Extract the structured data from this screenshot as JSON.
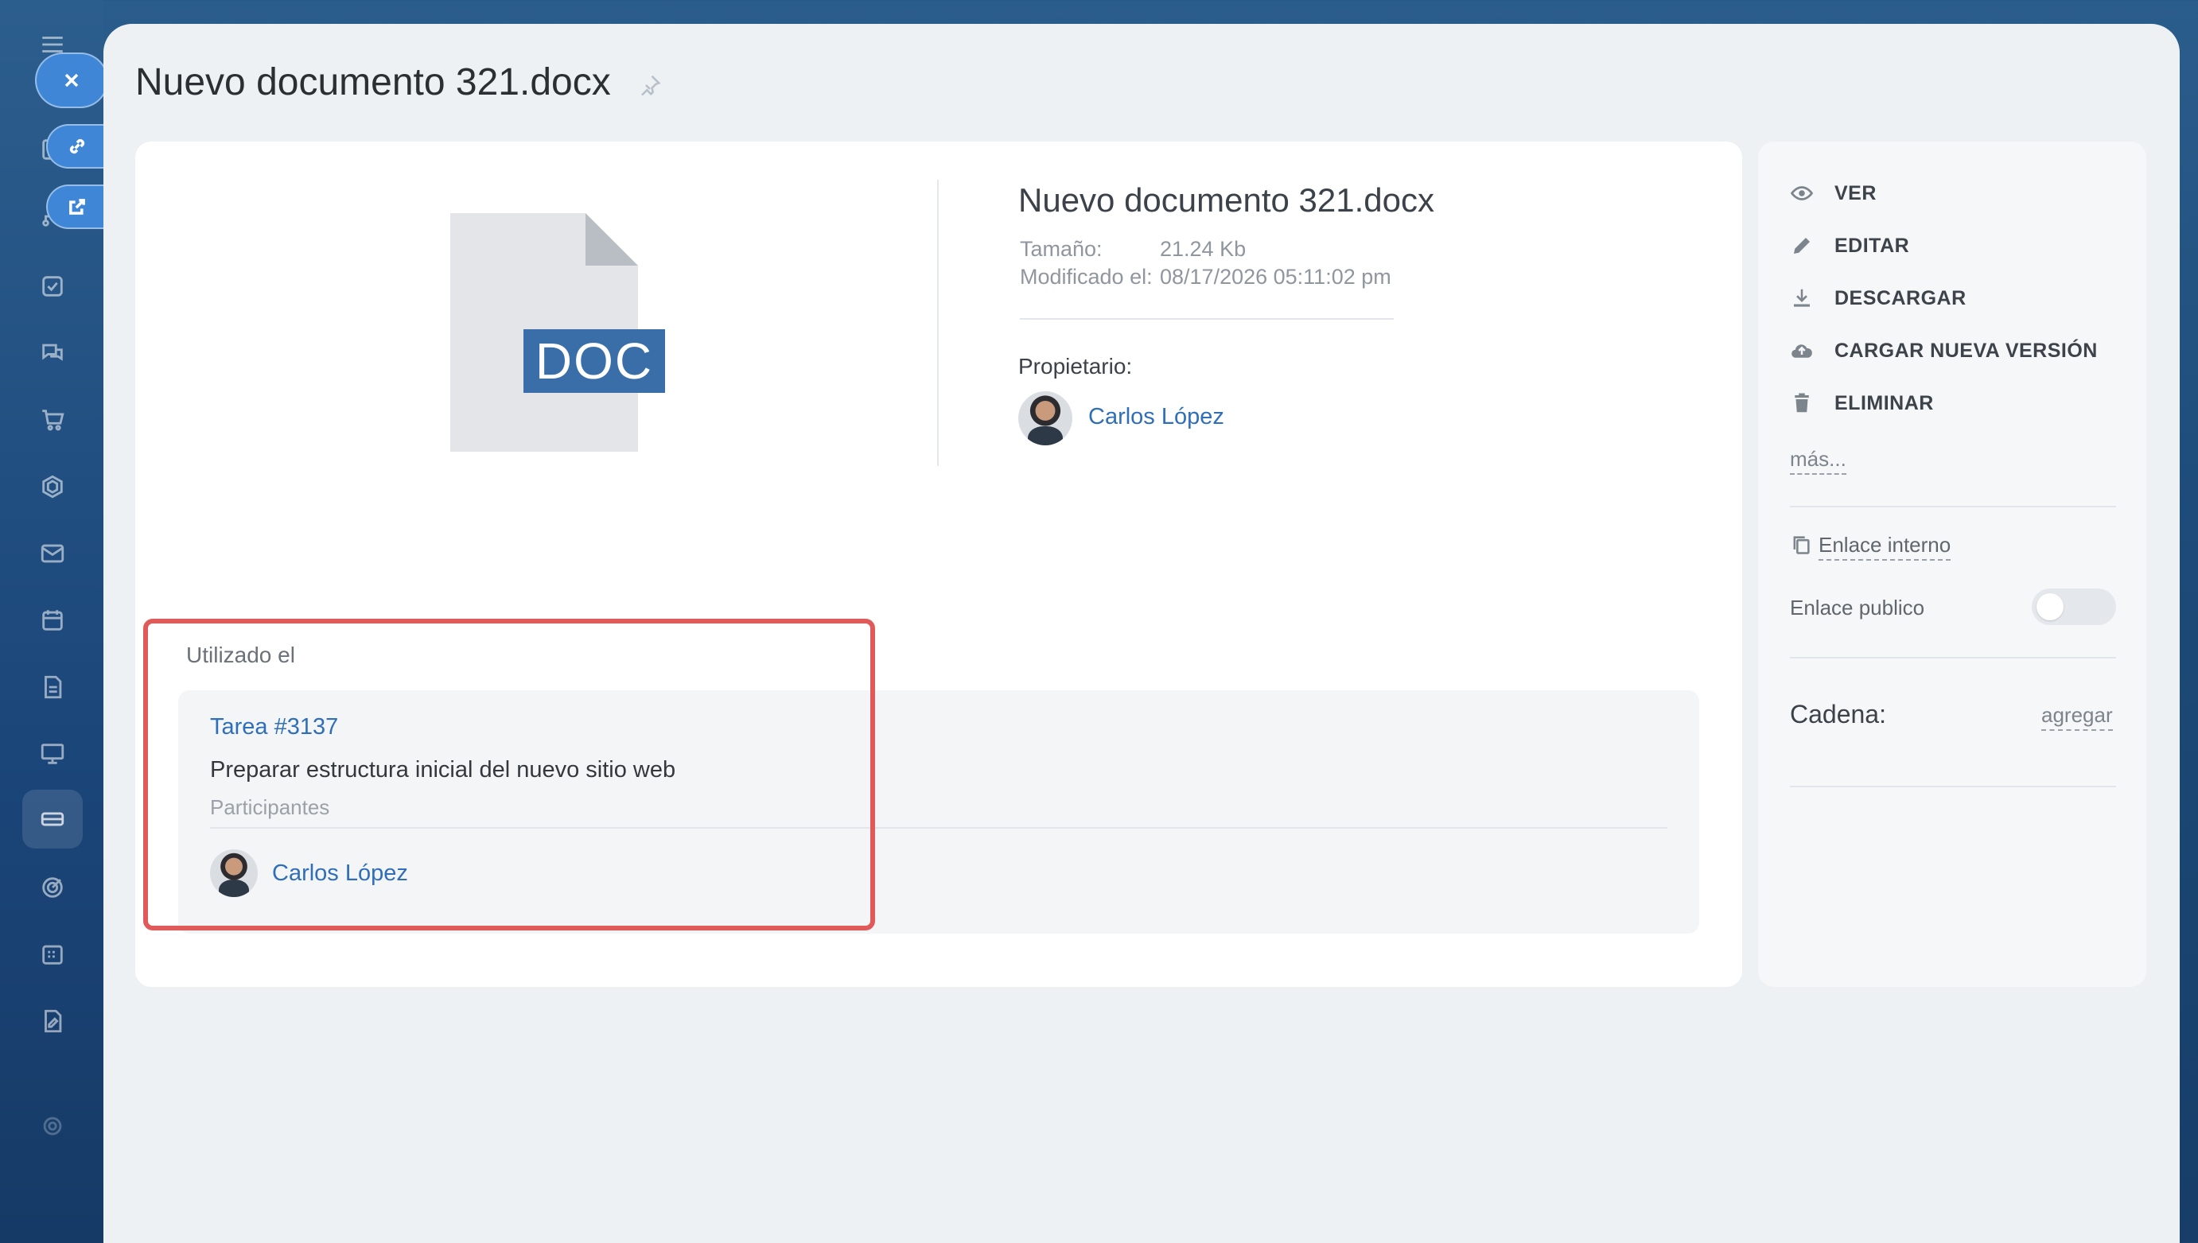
{
  "title": "Nuevo documento 321.docx",
  "file": {
    "name": "Nuevo documento 321.docx",
    "badge": "DOC",
    "size_label": "Tamaño:",
    "size_value": "21.24 Kb",
    "modified_label": "Modificado el:",
    "modified_value": "08/17/2026 05:11:02 pm",
    "owner_label": "Propietario:",
    "owner_name": "Carlos López"
  },
  "used_in": {
    "label": "Utilizado el",
    "task_link": "Tarea #3137",
    "task_description": "Preparar estructura inicial del nuevo sitio web",
    "participants_label": "Participantes",
    "participant_name": "Carlos López"
  },
  "actions": [
    {
      "label": "VER",
      "icon": "eye-icon"
    },
    {
      "label": "EDITAR",
      "icon": "pencil-icon"
    },
    {
      "label": "DESCARGAR",
      "icon": "download-icon"
    },
    {
      "label": "CARGAR NUEVA VERSIÓN",
      "icon": "cloud-upload-icon"
    },
    {
      "label": "ELIMINAR",
      "icon": "trash-icon"
    }
  ],
  "side": {
    "more": "más...",
    "internal_link": "Enlace interno",
    "public_link": "Enlace publico",
    "public_link_enabled": false,
    "chain_label": "Cadena:",
    "chain_add": "agregar"
  },
  "colors": {
    "accent": "#2f6eb8",
    "highlight_frame": "#e05a5a",
    "doc_badge": "#3a6ea8"
  }
}
